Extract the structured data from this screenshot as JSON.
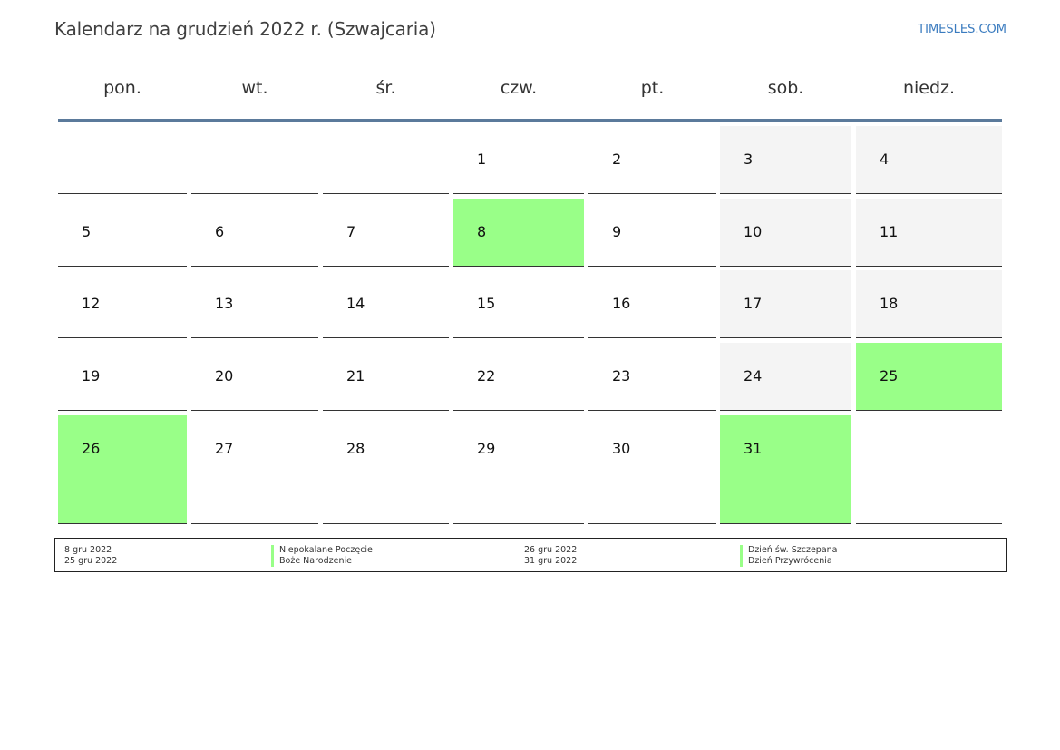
{
  "title": "Kalendarz na grudzień 2022 r. (Szwajcaria)",
  "brand": "TIMESLES.COM",
  "colors": {
    "holiday": "#99ff88",
    "weekend": "#f4f4f4",
    "rule": "#5b7a9b"
  },
  "weekdays": [
    "pon.",
    "wt.",
    "śr.",
    "czw.",
    "pt.",
    "sob.",
    "niedz."
  ],
  "weeks": [
    [
      {
        "n": ""
      },
      {
        "n": ""
      },
      {
        "n": ""
      },
      {
        "n": "1"
      },
      {
        "n": "2"
      },
      {
        "n": "3",
        "weekend": true
      },
      {
        "n": "4",
        "weekend": true
      }
    ],
    [
      {
        "n": "5"
      },
      {
        "n": "6"
      },
      {
        "n": "7"
      },
      {
        "n": "8",
        "holiday": true
      },
      {
        "n": "9"
      },
      {
        "n": "10",
        "weekend": true
      },
      {
        "n": "11",
        "weekend": true
      }
    ],
    [
      {
        "n": "12"
      },
      {
        "n": "13"
      },
      {
        "n": "14"
      },
      {
        "n": "15"
      },
      {
        "n": "16"
      },
      {
        "n": "17",
        "weekend": true
      },
      {
        "n": "18",
        "weekend": true
      }
    ],
    [
      {
        "n": "19"
      },
      {
        "n": "20"
      },
      {
        "n": "21"
      },
      {
        "n": "22"
      },
      {
        "n": "23"
      },
      {
        "n": "24",
        "weekend": true
      },
      {
        "n": "25",
        "holiday": true
      }
    ],
    [
      {
        "n": "26",
        "holiday": true
      },
      {
        "n": "27"
      },
      {
        "n": "28"
      },
      {
        "n": "29"
      },
      {
        "n": "30"
      },
      {
        "n": "31",
        "holiday": true
      },
      {
        "n": "",
        "empty": true
      }
    ]
  ],
  "legend": [
    {
      "date": "8 gru 2022",
      "name": "Niepokalane Poczęcie"
    },
    {
      "date": "25 gru 2022",
      "name": "Boże Narodzenie"
    },
    {
      "date": "26 gru 2022",
      "name": "Dzień św. Szczepana"
    },
    {
      "date": "31 gru 2022",
      "name": "Dzień Przywrócenia"
    }
  ]
}
